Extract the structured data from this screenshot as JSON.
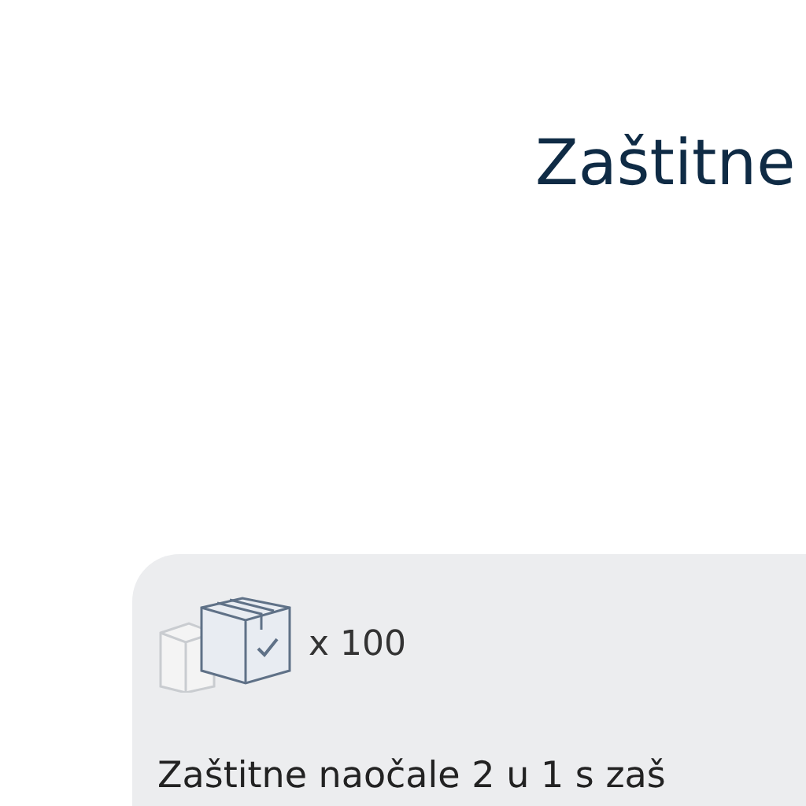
{
  "title": "Zaštitne",
  "card": {
    "quantity": "x 100",
    "product_name": "Zaštitne naočale 2 u 1 s zaš"
  }
}
